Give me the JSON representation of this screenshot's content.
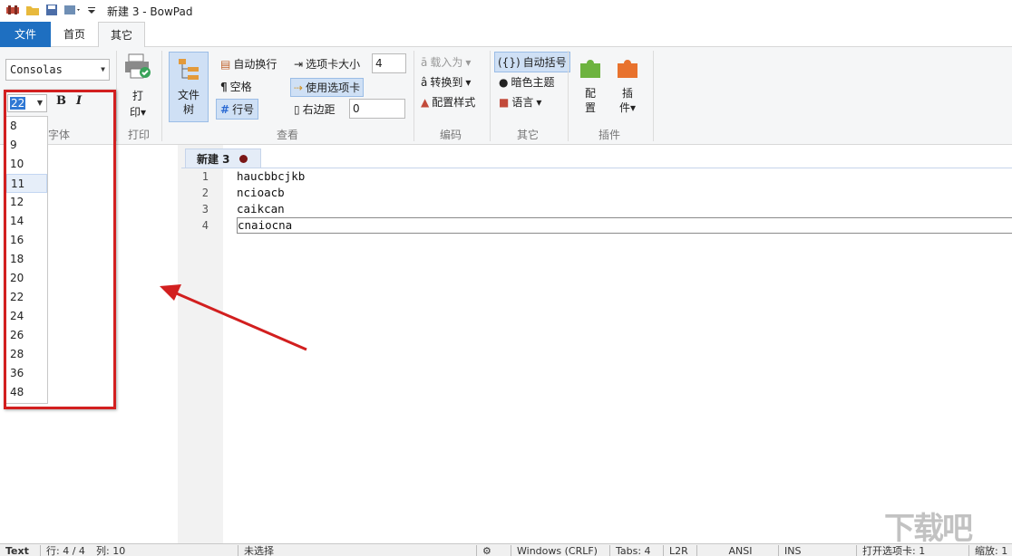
{
  "window": {
    "title": "新建 3 - BowPad"
  },
  "menu_tabs": [
    {
      "label": "文件"
    },
    {
      "label": "首页"
    },
    {
      "label": "其它"
    }
  ],
  "ribbon": {
    "font": {
      "family": "Consolas",
      "size": "22",
      "bold": "B",
      "italic": "I",
      "group": "字体"
    },
    "print": {
      "label": "打印",
      "group": "打印"
    },
    "view": {
      "file_tree": "文件树",
      "word_wrap": "自动换行",
      "whitespace": "空格",
      "line_numbers": "行号",
      "tab_size_label": "选项卡大小",
      "tab_size_value": "4",
      "use_tabs": "使用选项卡",
      "right_margin_label": "右边距",
      "right_margin_value": "0",
      "group": "查看"
    },
    "encoding": {
      "load_as": "载入为",
      "convert_to": "转换到",
      "config_style": "配置样式",
      "group": "编码"
    },
    "other": {
      "auto_brace": "自动括号",
      "dark_theme": "暗色主题",
      "language": "语言",
      "group": "其它"
    },
    "plugins": {
      "config": "配置",
      "plugin": "插件",
      "group": "插件"
    }
  },
  "font_size_options": [
    "8",
    "9",
    "10",
    "11",
    "12",
    "14",
    "16",
    "18",
    "20",
    "22",
    "24",
    "26",
    "28",
    "36",
    "48"
  ],
  "selected_option": "11",
  "document": {
    "tab_label": "新建 3",
    "lines": [
      "haucbbcjkb",
      "ncioacb",
      "caikcan",
      "cnaiocna"
    ],
    "line_numbers": [
      "1",
      "2",
      "3",
      "4"
    ]
  },
  "status": {
    "mode": "Text",
    "position": "行: 4 / 4",
    "column": "列: 10",
    "selection": "未选择",
    "eol": "Windows (CRLF)",
    "tabs": "Tabs: 4",
    "direction": "L2R",
    "encoding": "ANSI",
    "ins": "INS",
    "open_tabs": "打开选项卡: 1",
    "zoom": "缩放: 1"
  },
  "watermark": "下载吧",
  "colors": {
    "accent": "#1e6fc1",
    "highlight_box": "#d21f1f"
  }
}
